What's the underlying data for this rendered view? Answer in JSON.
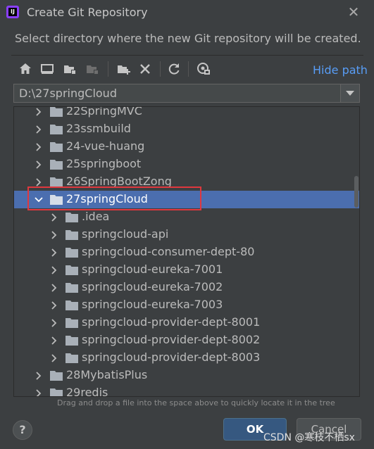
{
  "window": {
    "title": "Create Git Repository",
    "close_glyph": "✕"
  },
  "description": "Select directory where the new Git repository will be created.",
  "toolbar": {
    "icons": [
      "home-icon",
      "desktop-icon",
      "project-folder-icon",
      "module-folder-icon",
      "new-folder-icon",
      "delete-icon",
      "refresh-icon",
      "show-hidden-icon"
    ],
    "hide_path_label": "Hide path"
  },
  "path": {
    "value": "D:\\27springCloud"
  },
  "tree": {
    "rows": [
      {
        "label": "22SpringMVC",
        "level": 0,
        "expanded": false,
        "selected": false
      },
      {
        "label": "23ssmbuild",
        "level": 0,
        "expanded": false,
        "selected": false
      },
      {
        "label": "24-vue-huang",
        "level": 0,
        "expanded": false,
        "selected": false
      },
      {
        "label": "25springboot",
        "level": 0,
        "expanded": false,
        "selected": false
      },
      {
        "label": "26SpringBootZong",
        "level": 0,
        "expanded": false,
        "selected": false
      },
      {
        "label": "27springCloud",
        "level": 0,
        "expanded": true,
        "selected": true
      },
      {
        "label": ".idea",
        "level": 1,
        "expanded": false,
        "selected": false
      },
      {
        "label": "springcloud-api",
        "level": 1,
        "expanded": false,
        "selected": false
      },
      {
        "label": "springcloud-consumer-dept-80",
        "level": 1,
        "expanded": false,
        "selected": false
      },
      {
        "label": "springcloud-eureka-7001",
        "level": 1,
        "expanded": false,
        "selected": false
      },
      {
        "label": "springcloud-eureka-7002",
        "level": 1,
        "expanded": false,
        "selected": false
      },
      {
        "label": "springcloud-eureka-7003",
        "level": 1,
        "expanded": false,
        "selected": false
      },
      {
        "label": "springcloud-provider-dept-8001",
        "level": 1,
        "expanded": false,
        "selected": false
      },
      {
        "label": "springcloud-provider-dept-8002",
        "level": 1,
        "expanded": false,
        "selected": false
      },
      {
        "label": "springcloud-provider-dept-8003",
        "level": 1,
        "expanded": false,
        "selected": false
      },
      {
        "label": "28MybatisPlus",
        "level": 0,
        "expanded": false,
        "selected": false
      },
      {
        "label": "29redis",
        "level": 0,
        "expanded": false,
        "selected": false
      }
    ]
  },
  "hint": "Drag and drop a file into the space above to quickly locate it in the tree",
  "buttons": {
    "help": "?",
    "ok": "OK",
    "cancel": "Cancel"
  },
  "watermark": "CSDN @寒枝不栖sx",
  "colors": {
    "background": "#3c3f41",
    "selection": "#4b6eaf",
    "link": "#589df6",
    "highlight_box": "#e0383e",
    "ok_button": "#365880"
  }
}
